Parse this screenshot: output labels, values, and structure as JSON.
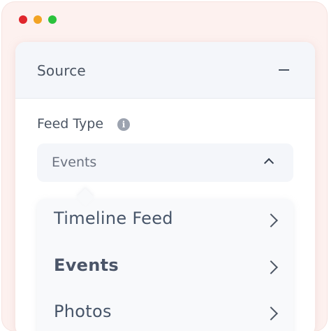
{
  "window": {
    "controls": [
      {
        "name": "close",
        "color": "#e0262c"
      },
      {
        "name": "minimize",
        "color": "#f2a324"
      },
      {
        "name": "maximize",
        "color": "#2bc23c"
      }
    ]
  },
  "panel": {
    "title": "Source",
    "collapse_icon": "minus-icon"
  },
  "feed_type": {
    "label": "Feed Type",
    "info_icon": "i",
    "selected_value": "Events",
    "options": [
      {
        "label": "Timeline Feed",
        "selected": false
      },
      {
        "label": "Events",
        "selected": true
      },
      {
        "label": "Photos",
        "selected": false
      }
    ]
  }
}
